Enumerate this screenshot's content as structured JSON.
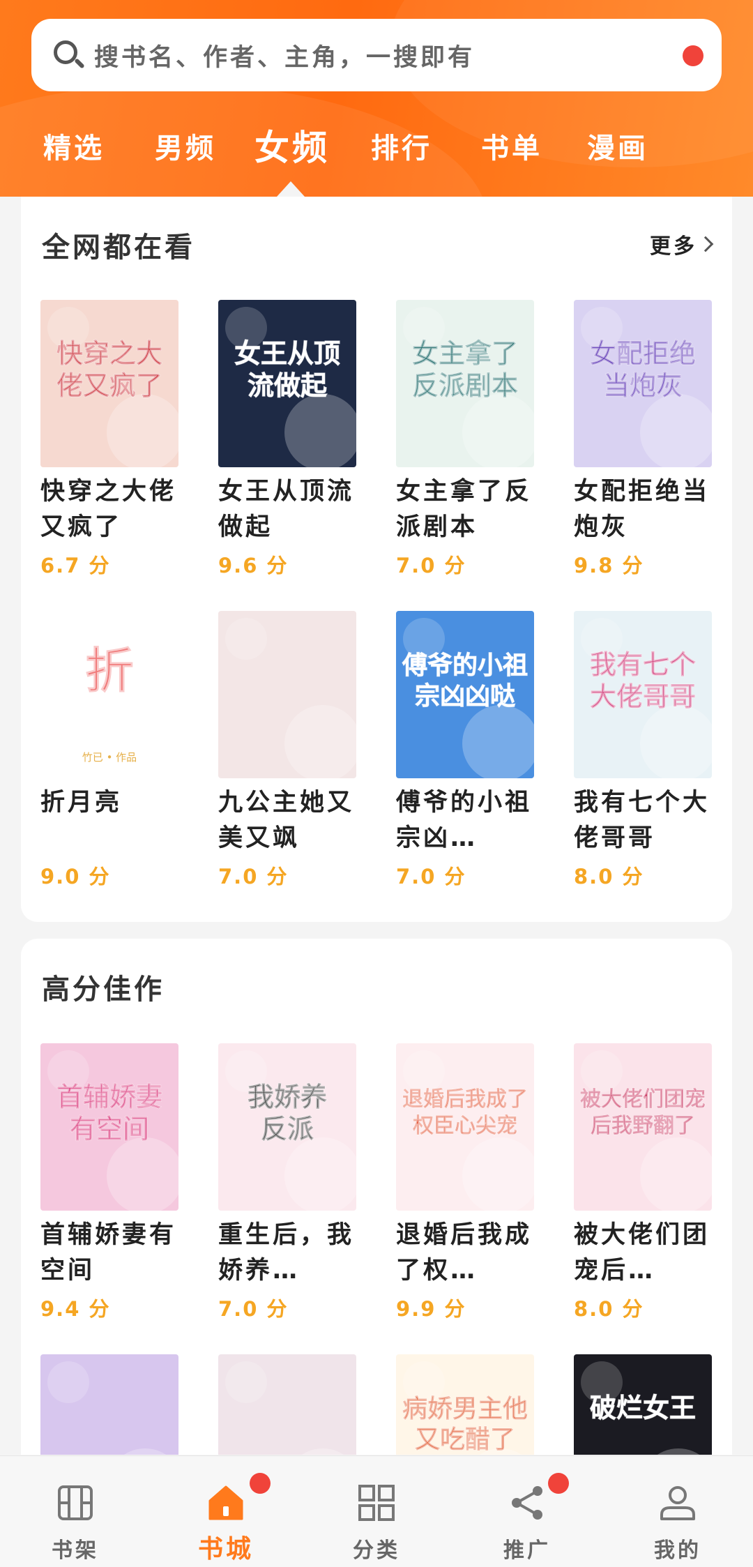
{
  "search": {
    "placeholder": "搜书名、作者、主角，一搜即有"
  },
  "tabs": [
    {
      "label": "精选",
      "active": false
    },
    {
      "label": "男频",
      "active": false
    },
    {
      "label": "女频",
      "active": true
    },
    {
      "label": "排行",
      "active": false
    },
    {
      "label": "书单",
      "active": false
    },
    {
      "label": "漫画",
      "active": false
    }
  ],
  "section1": {
    "title": "全网都在看",
    "more_label": "更多",
    "books": [
      {
        "title": "快穿之大佬又疯了",
        "score": "6.7 分",
        "cover_text": "快穿之大佬又疯了",
        "cover_bg": "#f6d9d0",
        "cover_fg": "#c9262e"
      },
      {
        "title": "女王从顶流做起",
        "score": "9.6 分",
        "cover_text": "女王从顶流做起",
        "cover_bg": "#1e2a45",
        "cover_fg": "#ffffff"
      },
      {
        "title": "女主拿了反派剧本",
        "score": "7.0 分",
        "cover_text": "女主拿了反派剧本",
        "cover_bg": "#e9f3ee",
        "cover_fg": "#1f6b6a"
      },
      {
        "title": "女配拒绝当炮灰",
        "score": "9.8 分",
        "cover_text": "女配拒绝当炮灰",
        "cover_bg": "#d9d2f2",
        "cover_fg": "#5b34b5"
      },
      {
        "title": "折月亮",
        "score": "9.0 分",
        "cover_text": "折",
        "cover_bg": "#ffffff",
        "cover_fg": "#f07a7a",
        "cover_sub": "竹已 • 作品"
      },
      {
        "title": "九公主她又美又飒",
        "score": "7.0 分",
        "cover_text": "",
        "cover_bg": "#f3e6e6",
        "cover_fg": "#7a2b2b"
      },
      {
        "title": "傅爷的小祖宗凶…",
        "score": "7.0 分",
        "cover_text": "傅爷的小祖宗凶凶哒",
        "cover_bg": "#4a8fe0",
        "cover_fg": "#ffffff"
      },
      {
        "title": "我有七个大佬哥哥",
        "score": "8.0 分",
        "cover_text": "我有七个大佬哥哥",
        "cover_bg": "#e8f2f6",
        "cover_fg": "#d03a78"
      }
    ]
  },
  "section2": {
    "title": "高分佳作",
    "books": [
      {
        "title": "首辅娇妻有空间",
        "score": "9.4 分",
        "cover_text": "首辅娇妻有空间",
        "cover_bg": "#f5c8de",
        "cover_fg": "#d6246e"
      },
      {
        "title": "重生后，我娇养…",
        "score": "7.0 分",
        "cover_text": "我娇养反派",
        "cover_bg": "#fbe9ee",
        "cover_fg": "#333333"
      },
      {
        "title": "退婚后我成了权…",
        "score": "9.9 分",
        "cover_text": "退婚后我成了权臣心尖宠",
        "cover_bg": "#fdeef0",
        "cover_fg": "#e04a2a"
      },
      {
        "title": "被大佬们团宠后…",
        "score": "8.0 分",
        "cover_text": "被大佬们团宠后我野翻了",
        "cover_bg": "#fbe3ea",
        "cover_fg": "#c21a4a"
      },
      {
        "title": "",
        "score": "",
        "cover_text": "",
        "cover_bg": "#d7c6ee",
        "cover_fg": "#ffffff"
      },
      {
        "title": "",
        "score": "",
        "cover_text": "",
        "cover_bg": "#f0e4ea",
        "cover_fg": "#ffffff"
      },
      {
        "title": "",
        "score": "",
        "cover_text": "病娇男主他又吃醋了",
        "cover_bg": "#fff6e8",
        "cover_fg": "#e0562a"
      },
      {
        "title": "",
        "score": "",
        "cover_text": "破烂女王",
        "cover_bg": "#1b1b22",
        "cover_fg": "#ffffff"
      }
    ]
  },
  "bottom_nav": [
    {
      "label": "书架",
      "icon": "bookshelf-icon",
      "active": false,
      "badge": false
    },
    {
      "label": "书城",
      "icon": "home-icon",
      "active": true,
      "badge": true
    },
    {
      "label": "分类",
      "icon": "grid-icon",
      "active": false,
      "badge": false
    },
    {
      "label": "推广",
      "icon": "share-icon",
      "active": false,
      "badge": true
    },
    {
      "label": "我的",
      "icon": "user-icon",
      "active": false,
      "badge": false
    }
  ],
  "colors": {
    "accent": "#ff7a1c",
    "score": "#f5a623",
    "badge": "#f0433a"
  }
}
